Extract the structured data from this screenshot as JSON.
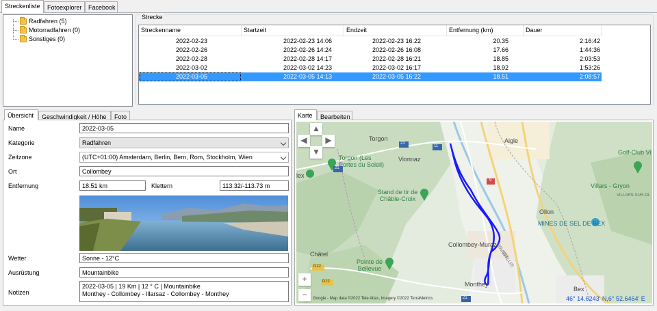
{
  "top_tabs": [
    "Streckenliste",
    "Fotoexplorer",
    "Facebook"
  ],
  "tree": [
    {
      "label": "Radfahren (5)"
    },
    {
      "label": "Motorradfahren (0)"
    },
    {
      "label": "Sonstiges (0)"
    }
  ],
  "strecke": {
    "group_label": "Strecke",
    "columns": [
      "Streckenname",
      "Startzeit",
      "Endzeit",
      "Entfernung (km)",
      "Dauer"
    ],
    "rows": [
      {
        "name": "2022-02-23",
        "start": "2022-02-23 14:06",
        "end": "2022-02-23 16:22",
        "dist": "20.35",
        "dur": "2:16:42"
      },
      {
        "name": "2022-02-26",
        "start": "2022-02-26 14:24",
        "end": "2022-02-26 16:08",
        "dist": "17.66",
        "dur": "1:44:36"
      },
      {
        "name": "2022-02-28",
        "start": "2022-02-28 14:17",
        "end": "2022-02-28 16:21",
        "dist": "18.85",
        "dur": "2:03:53"
      },
      {
        "name": "2022-03-02",
        "start": "2022-03-02 14:23",
        "end": "2022-03-02 16:17",
        "dist": "18.92",
        "dur": "1:53:26"
      },
      {
        "name": "2022-03-05",
        "start": "2022-03-05 14:13",
        "end": "2022-03-05 16:22",
        "dist": "18.51",
        "dur": "2:08:57"
      }
    ],
    "selected_index": 4
  },
  "detail_tabs": [
    "Übersicht",
    "Geschwindigkeit / Höhe",
    "Foto"
  ],
  "form": {
    "name_label": "Name",
    "name_value": "2022-03-05",
    "kategorie_label": "Kategorie",
    "kategorie_value": "Radfahren",
    "zeitzone_label": "Zeitzone",
    "zeitzone_value": "(UTC+01:00) Amsterdam, Berlin, Bern, Rom, Stockholm, Wien",
    "ort_label": "Ort",
    "ort_value": "Collombey",
    "entfernung_label": "Entfernung",
    "entfernung_value": "18.51 km",
    "klettern_label": "Klettern",
    "klettern_value": "113.32/-113.73 m",
    "wetter_label": "Wetter",
    "wetter_value": "Sonne  -  12°C",
    "ausruestung_label": "Ausrüstung",
    "ausruestung_value": "Mountainbike",
    "notizen_label": "Notizen",
    "notizen_line1": "2022-03-05  | 19 Km | 12 ° C | Mountainbike",
    "notizen_line2": "Monthey - Collombey - Illarsaz - Collombey - Monthey"
  },
  "map_tabs": [
    "Karte",
    "Bearbeiten"
  ],
  "map": {
    "labels": {
      "torgon": "Torgon",
      "torgon_poi": "Torgon (Les Portes du Soleil)",
      "vionnaz": "Vionnaz",
      "aigle": "Aigle",
      "golf": "Golf-Club Vi",
      "villars": "Villars - Gryon",
      "villars_sur": "VILLARS-SUR-OL",
      "stand": "Stand de tir de Châble-Croix",
      "ollon": "Ollon",
      "mines": "MINES DE SEL DE BEX",
      "collombey": "Collombey-Muraz",
      "chatel": "Châtel",
      "pointe": "Pointe de Bellevue",
      "monthey": "Monthey",
      "bex": "Bex",
      "waadt": "WAADT",
      "wallis": "WALLIS",
      "lex": "lex"
    },
    "road_numbers": [
      "21",
      "11",
      "9",
      "21",
      "D22",
      "D22",
      "21"
    ],
    "attribution": "Google - Map data ©2022 Tele Atlas, Imagery ©2022 TerraMetrics",
    "coordinates": "46° 14.6243' N,6° 52.6464' E",
    "route_color": "#1a1aff"
  }
}
